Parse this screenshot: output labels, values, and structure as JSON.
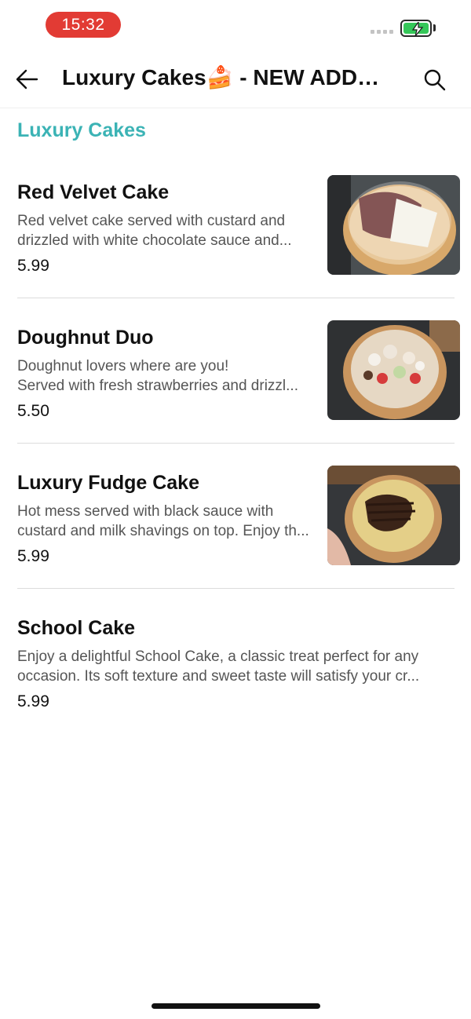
{
  "status_bar": {
    "time": "15:32",
    "battery_state": "charging",
    "battery_color": "#35c759",
    "time_pill_color": "#e23b34"
  },
  "header": {
    "back_icon": "arrow-left-icon",
    "title": "Luxury Cakes🍰 - NEW ADDITIONS",
    "search_icon": "search-icon"
  },
  "section": {
    "title": "Luxury Cakes",
    "accent_color": "#3bb3b5"
  },
  "items": [
    {
      "name": "Red Velvet Cake",
      "desc_line1": "Red velvet cake served with custard and",
      "desc_line2": "drizzled with white chocolate sauce and...",
      "price": "5.99",
      "image": "red-velvet-cake-photo"
    },
    {
      "name": "Doughnut Duo",
      "desc_line1": "Doughnut lovers where are you!",
      "desc_line2": "Served with fresh strawberries and drizzl...",
      "price": "5.50",
      "image": "doughnut-duo-photo"
    },
    {
      "name": "Luxury Fudge Cake",
      "desc_line1": "Hot mess served with black sauce with",
      "desc_line2": "custard and milk shavings on top. Enjoy th...",
      "price": "5.99",
      "image": "luxury-fudge-cake-photo"
    },
    {
      "name": "School Cake",
      "desc_line1": "Enjoy a delightful School Cake, a classic treat perfect for any",
      "desc_line2": "occasion. Its soft texture and sweet taste will satisfy your cr...",
      "price": "5.99",
      "image": null
    }
  ]
}
